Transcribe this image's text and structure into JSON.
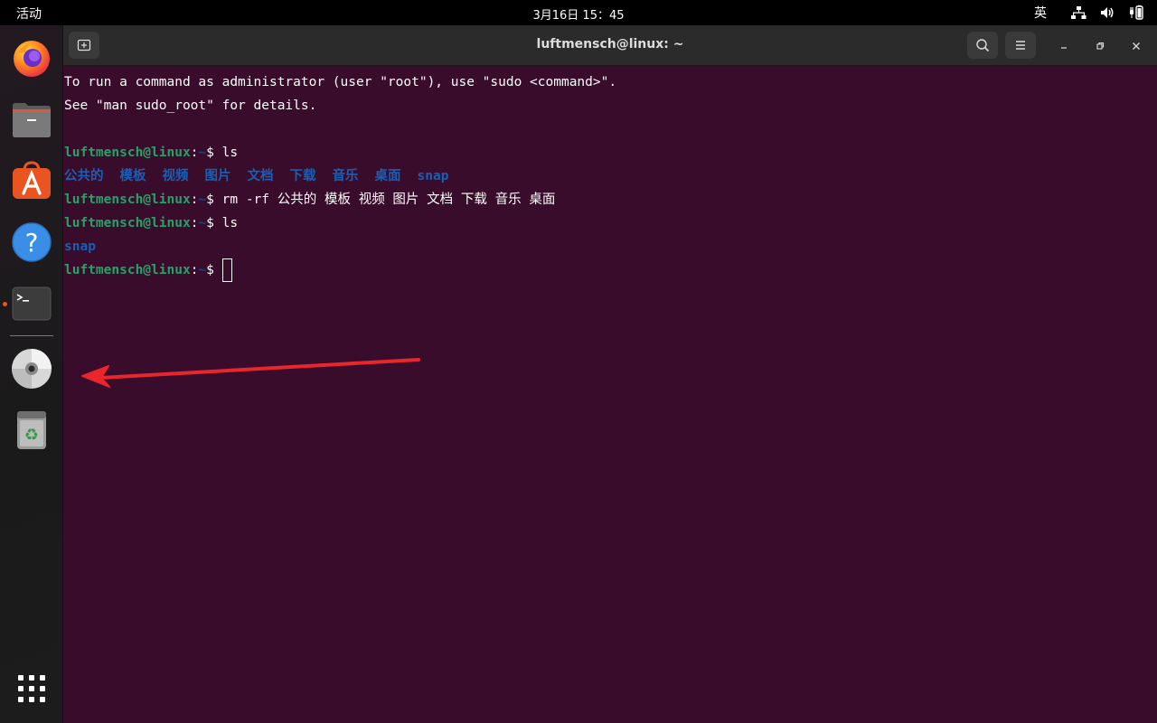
{
  "topbar": {
    "activities": "活动",
    "clock": "3月16日  15：45",
    "ime": "英"
  },
  "dock": {
    "apps": [
      {
        "name": "firefox",
        "icon": "firefox-icon"
      },
      {
        "name": "files",
        "icon": "files-icon"
      },
      {
        "name": "app-center",
        "icon": "app-center-icon"
      },
      {
        "name": "help",
        "icon": "help-icon"
      },
      {
        "name": "terminal",
        "icon": "terminal-icon",
        "running": true
      },
      {
        "name": "disc",
        "icon": "disc-icon"
      },
      {
        "name": "trash",
        "icon": "trash-icon"
      },
      {
        "name": "show-apps",
        "icon": "app-grid-icon"
      }
    ]
  },
  "window": {
    "title": "luftmensch@linux: ~"
  },
  "terminal": {
    "motd_1": "To run a command as administrator (user \"root\"), use \"sudo <command>\".",
    "motd_2": "See \"man sudo_root\" for details.",
    "user_host": "luftmensch@linux",
    "colon": ":",
    "path": "~",
    "dollar": "$ ",
    "cmd_1": "ls",
    "ls_1": [
      "公共的",
      "模板",
      "视频",
      "图片",
      "文档",
      "下载",
      "音乐",
      "桌面",
      "snap"
    ],
    "cmd_2": "rm -rf 公共的 模板 视频 图片 文档 下载 音乐 桌面",
    "cmd_3": "ls",
    "ls_2": "snap"
  },
  "annotation": {
    "arrow_color": "#e8262b"
  }
}
